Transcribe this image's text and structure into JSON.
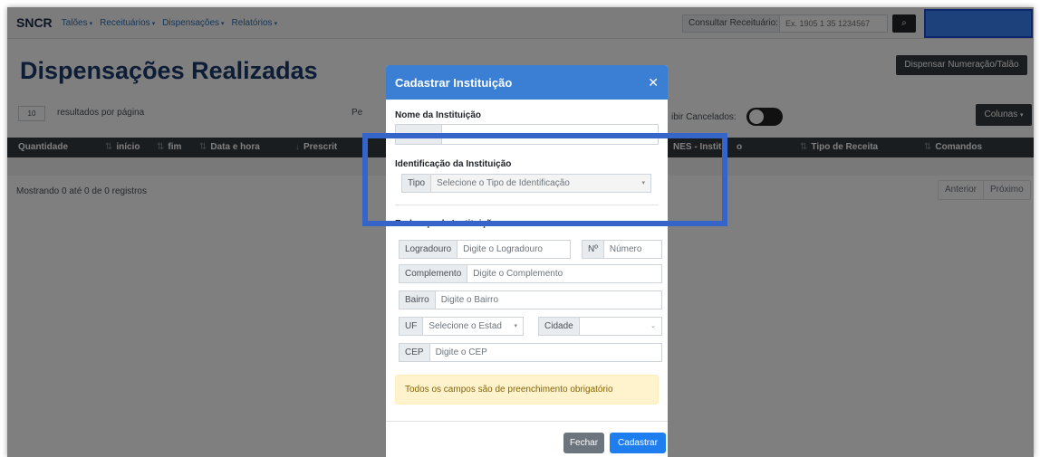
{
  "navbar": {
    "brand": "SNCR",
    "menus": [
      "Talões",
      "Receituários",
      "Dispensações",
      "Relatórios"
    ],
    "consult_label": "Consultar Receituário:",
    "consult_placeholder": "Ex. 1905 1 35 1234567"
  },
  "page": {
    "title": "Dispensações Realizadas",
    "dispense_button": "Dispensar Numeração/Talão",
    "per_page_value": "10",
    "per_page_label": "resultados por página",
    "pe_fragment": "Pe",
    "show_cancelled_label": "ibir Cancelados:",
    "columns_button": "Colunas",
    "table_headers": [
      "Quantidade",
      "início",
      "fim",
      "Data e hora",
      "Prescrit",
      "NES - Institu",
      "o",
      "Tipo de Receita",
      "Comandos"
    ],
    "showing_text": "Mostrando 0 até 0 de 0 registros",
    "pager": {
      "prev": "Anterior",
      "next": "Próximo"
    }
  },
  "modal": {
    "title": "Cadastrar Instituição",
    "name_section": "Nome da Instituição",
    "identification_section": "Identificação da Instituição",
    "tipo_label": "Tipo",
    "tipo_placeholder": "Selecione o Tipo de Identificação",
    "address_section": "Endereço da Instituição",
    "logradouro_label": "Logradouro",
    "logradouro_placeholder": "Digite o Logradouro",
    "numero_label": "Nº",
    "numero_placeholder": "Número",
    "complemento_label": "Complemento",
    "complemento_placeholder": "Digite o Complemento",
    "bairro_label": "Bairro",
    "bairro_placeholder": "Digite o Bairro",
    "uf_label": "UF",
    "uf_placeholder": "Selecione o Estad",
    "cidade_label": "Cidade",
    "cidade_value": "",
    "cep_label": "CEP",
    "cep_placeholder": "Digite o CEP",
    "alert_text": "Todos os campos são de preenchimento obrigatório",
    "close_button": "Fechar",
    "submit_button": "Cadastrar"
  },
  "colors": {
    "primary": "#3b7fd4",
    "highlight": "#3565c9",
    "user_box": "#3b82f6",
    "dark": "#343a40"
  }
}
